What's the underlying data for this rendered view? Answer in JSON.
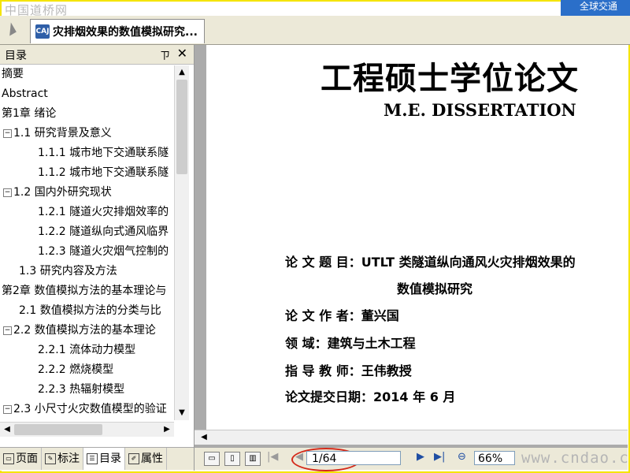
{
  "watermark_top": "中国道桥网",
  "top_right_tab": "全球交通",
  "document_tab": {
    "title": "灾排烟效果的数值模拟研究..."
  },
  "sidebar": {
    "title": "目录",
    "pin_label": "ㄗ",
    "close_label": "✕",
    "items": [
      {
        "label": "摘要",
        "toggle": ""
      },
      {
        "label": "Abstract",
        "toggle": ""
      },
      {
        "label": "第1章 绪论",
        "toggle": ""
      },
      {
        "label": "1.1 研究背景及意义",
        "toggle": "−"
      },
      {
        "label": "1.1.1 城市地下交通联系隧",
        "toggle": ""
      },
      {
        "label": "1.1.2 城市地下交通联系隧",
        "toggle": ""
      },
      {
        "label": "1.2 国内外研究现状",
        "toggle": "−"
      },
      {
        "label": "1.2.1 隧道火灾排烟效率的",
        "toggle": ""
      },
      {
        "label": "1.2.2 隧道纵向式通风临界",
        "toggle": ""
      },
      {
        "label": "1.2.3 隧道火灾烟气控制的",
        "toggle": ""
      },
      {
        "label": "1.3 研究内容及方法",
        "toggle": ""
      },
      {
        "label": "第2章 数值模拟方法的基本理论与",
        "toggle": ""
      },
      {
        "label": "2.1 数值模拟方法的分类与比",
        "toggle": ""
      },
      {
        "label": "2.2 数值模拟方法的基本理论",
        "toggle": "−"
      },
      {
        "label": "2.2.1 流体动力模型",
        "toggle": ""
      },
      {
        "label": "2.2.2 燃烧模型",
        "toggle": ""
      },
      {
        "label": "2.2.3 热辐射模型",
        "toggle": ""
      },
      {
        "label": "2.3 小尺寸火灾数值模型的验证",
        "toggle": "−"
      }
    ],
    "bottom_tabs": [
      {
        "label": "页面",
        "icon": "page-icon"
      },
      {
        "label": "标注",
        "icon": "pencil-icon"
      },
      {
        "label": "目录",
        "icon": "toc-icon"
      },
      {
        "label": "属性",
        "icon": "properties-icon"
      }
    ]
  },
  "page": {
    "title": "工程硕士学位论文",
    "subtitle": "M.E. DISSERTATION",
    "fields": [
      {
        "label": "论  文  题  目：",
        "value": "UTLT 类隧道纵向通风火灾排烟效果的"
      },
      {
        "label": "",
        "value": "数值模拟研究"
      },
      {
        "label": "论  文  作  者：",
        "value": "董兴国"
      },
      {
        "label": "领          域：",
        "value": "建筑与土木工程"
      },
      {
        "label": "指  导  教  师：",
        "value": "王伟教授"
      },
      {
        "label": "论文提交日期：",
        "value": "2014 年 6 月"
      }
    ]
  },
  "toolbar": {
    "page_indicator": "1/64",
    "zoom": "66%",
    "watermark": "www.cndao.com"
  }
}
